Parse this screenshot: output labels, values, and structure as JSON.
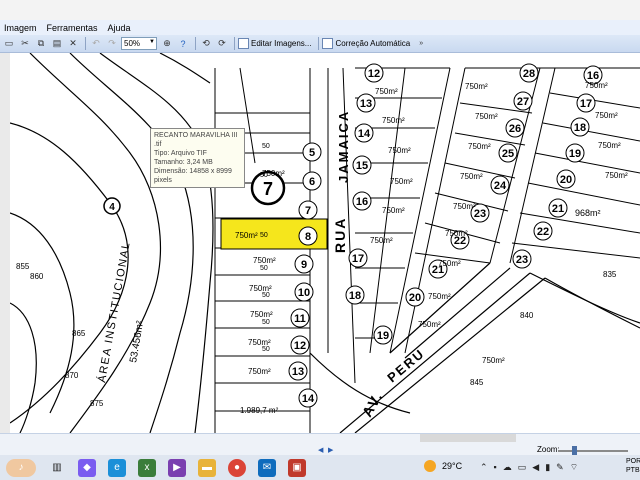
{
  "menu": [
    "Imagem",
    "Ferramentas",
    "Ajuda"
  ],
  "toolbar": {
    "zoom_value": "50%",
    "edit_images": "Editar Imagens...",
    "auto_correct": "Correção Automática"
  },
  "tooltip": {
    "filename": "RECANTO MARAVILHA III .tif",
    "type": "Tipo: Arquivo TIF",
    "size": "Tamanho: 3,24 MB",
    "dimension": "Dimensão: 14858 x 8999",
    "unit": "pixels"
  },
  "map": {
    "streets": {
      "jamaica_a": "RUA",
      "jamaica_b": "JAMAICA",
      "peru_a": "AV.",
      "peru_b": "PERU",
      "institucional": "ÁREA INSTITUCIONAL",
      "inst_area": "53.456m²"
    },
    "area_label": "750m²",
    "width_label": "50",
    "big_area": "1.989,7 m²",
    "contour_labels": [
      "855",
      "860",
      "865",
      "870",
      "875",
      "840",
      "845",
      "835"
    ],
    "block_number": "7",
    "zone_number": "4",
    "left_lots": [
      "5",
      "6",
      "7",
      "8",
      "9",
      "10",
      "11",
      "12",
      "13",
      "14"
    ],
    "mid_lots": [
      "12",
      "13",
      "14",
      "15",
      "16",
      "17",
      "18",
      "19",
      "20",
      "21",
      "22",
      "23",
      "24",
      "25",
      "26",
      "27",
      "28"
    ],
    "right_lots": [
      "16",
      "17",
      "18",
      "19",
      "20",
      "21",
      "22",
      "23"
    ],
    "right_area": "968m²"
  },
  "status": {
    "zoom_label": "Zoom:"
  },
  "system": {
    "temperature": "29°C",
    "lang_a": "POR",
    "lang_b": "PTB"
  },
  "colors": {
    "highlight": "#f5e61c",
    "menubar": "#e9f0fb",
    "toolbar": "#c9d9f0"
  }
}
